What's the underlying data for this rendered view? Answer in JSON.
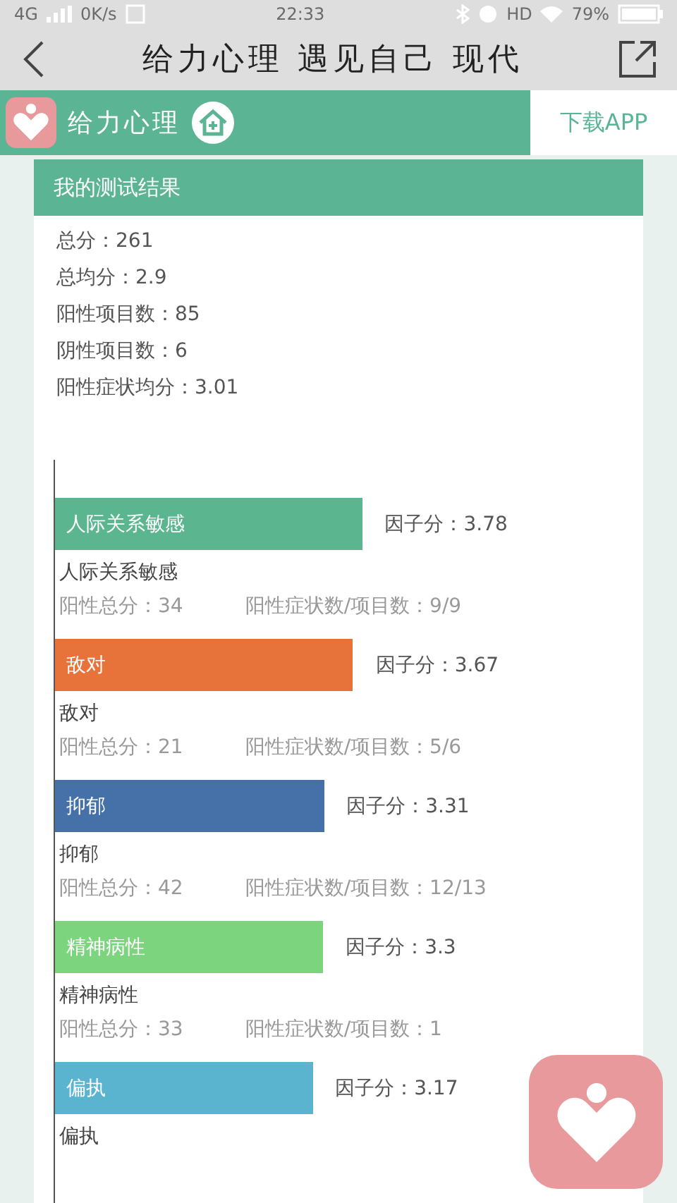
{
  "status_bar": {
    "network": "4G",
    "speed": "0K/s",
    "time": "22:33",
    "hd": "HD",
    "battery": "79%"
  },
  "nav": {
    "title": "给力心理 遇见自己 现代"
  },
  "brand_bar": {
    "name": "给力心理",
    "download": "下载APP"
  },
  "card": {
    "title": "我的测试结果",
    "summary": [
      "总分：261",
      "总均分：2.9",
      "阳性项目数：85",
      "阴性项目数：6",
      "阳性症状均分：3.01"
    ],
    "factors": [
      {
        "name": "人际关系敏感",
        "color": "#5bb690",
        "score": "因子分：3.78",
        "label": "人际关系敏感",
        "total": "阳性总分：34",
        "ratio": "阳性症状数/项目数：9/9"
      },
      {
        "name": "敌对",
        "color": "#e8733a",
        "score": "因子分：3.67",
        "label": "敌对",
        "total": "阳性总分：21",
        "ratio": "阳性症状数/项目数：5/6"
      },
      {
        "name": "抑郁",
        "color": "#4571a8",
        "score": "因子分：3.31",
        "label": "抑郁",
        "total": "阳性总分：42",
        "ratio": "阳性症状数/项目数：12/13"
      },
      {
        "name": "精神病性",
        "color": "#7dd47e",
        "score": "因子分：3.3",
        "label": "精神病性",
        "total": "阳性总分：33",
        "ratio": "阳性症状数/项目数：1"
      },
      {
        "name": "偏执",
        "color": "#5ab4cf",
        "score": "因子分：3.17",
        "label": "偏执"
      }
    ]
  }
}
